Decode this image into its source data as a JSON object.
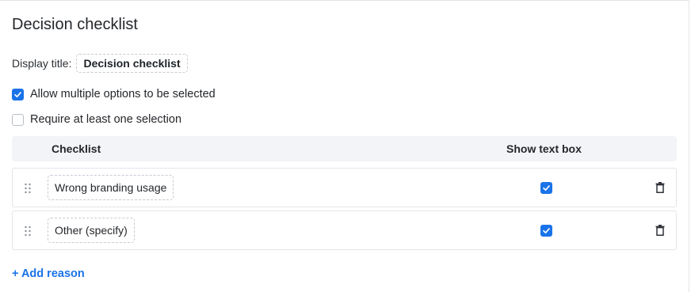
{
  "page": {
    "title": "Decision checklist"
  },
  "display": {
    "label": "Display title:",
    "value": "Decision checklist"
  },
  "options": {
    "allow_multiple": {
      "label": "Allow multiple options to be selected",
      "checked": true
    },
    "require_one": {
      "label": "Require at least one selection",
      "checked": false
    }
  },
  "table": {
    "headers": {
      "checklist": "Checklist",
      "show_text_box": "Show text box"
    },
    "rows": [
      {
        "reason": "Wrong branding usage",
        "show_text_box": true
      },
      {
        "reason": "Other (specify)",
        "show_text_box": true
      }
    ]
  },
  "actions": {
    "add_reason": "+ Add reason"
  },
  "colors": {
    "accent": "#1a73e8",
    "header_bg": "#f3f4f7",
    "border": "#e3e5e9"
  },
  "icons": [
    "drag-handle-icon",
    "trash-icon",
    "checkmark-icon"
  ]
}
